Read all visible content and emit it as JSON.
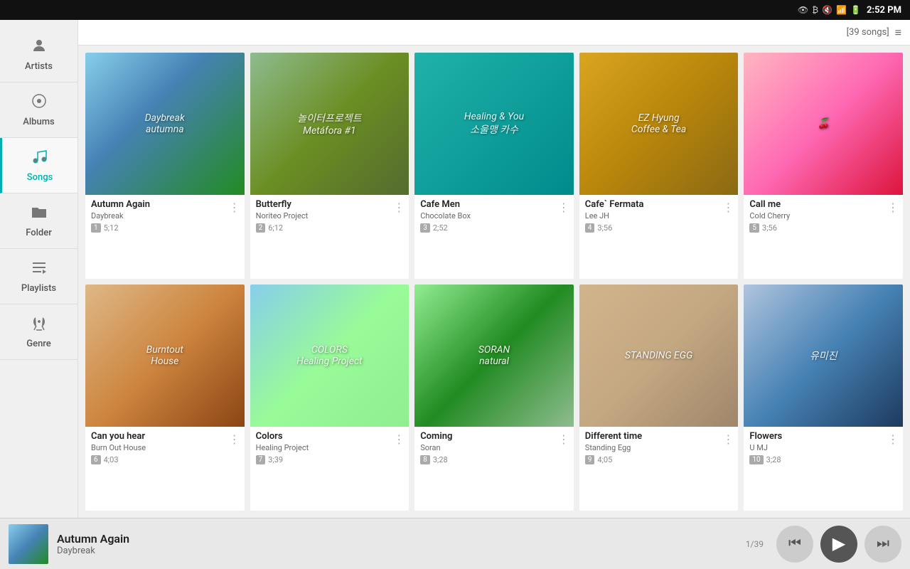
{
  "statusBar": {
    "time": "2:52 PM",
    "songCount": "[39 songs]"
  },
  "sidebar": {
    "items": [
      {
        "id": "artists",
        "label": "Artists",
        "icon": "👤",
        "active": false
      },
      {
        "id": "albums",
        "label": "Albums",
        "icon": "💿",
        "active": false
      },
      {
        "id": "songs",
        "label": "Songs",
        "icon": "🎵",
        "active": true
      },
      {
        "id": "folder",
        "label": "Folder",
        "icon": "📁",
        "active": false
      },
      {
        "id": "playlists",
        "label": "Playlists",
        "icon": "≡♪",
        "active": false
      },
      {
        "id": "genre",
        "label": "Genre",
        "icon": "🎸",
        "active": false
      }
    ]
  },
  "albums": [
    {
      "id": 1,
      "title": "Autumn Again",
      "artist": "Daybreak",
      "track": "1",
      "duration": "5;12",
      "artClass": "art-1",
      "artText": "Daybreak\nautumna"
    },
    {
      "id": 2,
      "title": "Butterfly",
      "artist": "Noriteo Project",
      "track": "2",
      "duration": "6;12",
      "artClass": "art-2",
      "artText": "놀이터프로젝트\nMetáfora #1"
    },
    {
      "id": 3,
      "title": "Cafe Men",
      "artist": "Chocolate Box",
      "track": "3",
      "duration": "2;52",
      "artClass": "art-3",
      "artText": "Healing & You\n소울맹 카수"
    },
    {
      "id": 4,
      "title": "Cafe` Fermata",
      "artist": "Lee JH",
      "track": "4",
      "duration": "3;56",
      "artClass": "art-4",
      "artText": "EZ Hyung\nCoffee & Tea"
    },
    {
      "id": 5,
      "title": "Call me",
      "artist": "Cold Cherry",
      "track": "5",
      "duration": "3;56",
      "artClass": "art-5",
      "artText": "🍒"
    },
    {
      "id": 6,
      "title": "Can you hear",
      "artist": "Burn Out House",
      "track": "6",
      "duration": "4;03",
      "artClass": "art-6",
      "artText": "Burntout\nHouse"
    },
    {
      "id": 7,
      "title": "Colors",
      "artist": "Healing Project",
      "track": "7",
      "duration": "3;39",
      "artClass": "art-7",
      "artText": "COLORS\nHealing Project"
    },
    {
      "id": 8,
      "title": "Coming",
      "artist": "Soran",
      "track": "8",
      "duration": "3;28",
      "artClass": "art-8",
      "artText": "SORAN\nnatural"
    },
    {
      "id": 9,
      "title": "Different time",
      "artist": "Standing Egg",
      "track": "9",
      "duration": "4;05",
      "artClass": "art-9",
      "artText": "STANDING EGG"
    },
    {
      "id": 10,
      "title": "Flowers",
      "artist": "U MJ",
      "track": "10",
      "duration": "3;28",
      "artClass": "art-10",
      "artText": "유미진"
    }
  ],
  "player": {
    "title": "Autumn Again",
    "artist": "Daybreak",
    "progress": "1/39"
  }
}
